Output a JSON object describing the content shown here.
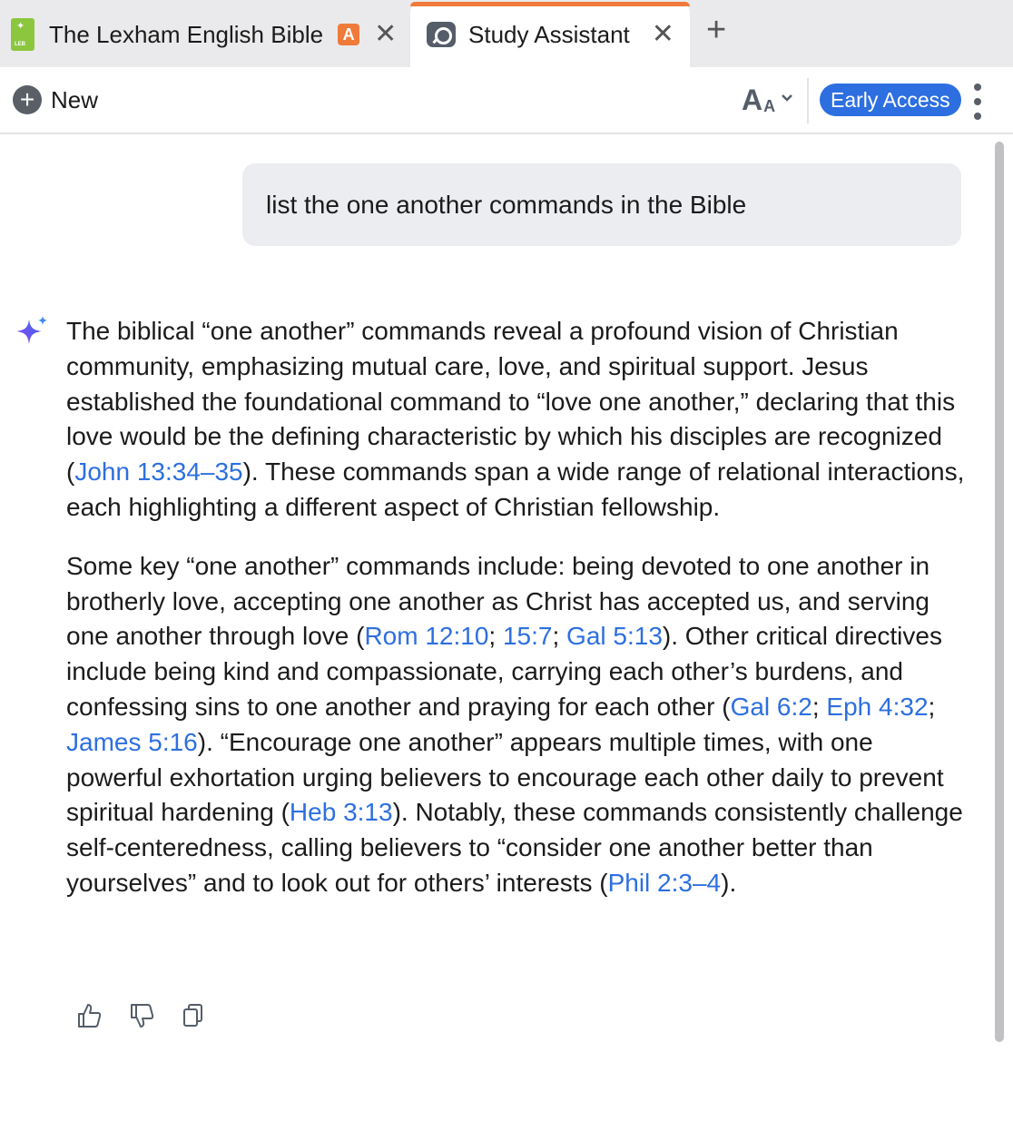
{
  "tabs": [
    {
      "label": "The Lexham English Bible",
      "badge": "A",
      "close": "✕"
    },
    {
      "label": "Study Assistant",
      "close": "✕"
    }
  ],
  "new_tab_symbol": "+",
  "toolbar": {
    "new_label": "New",
    "new_symbol": "+",
    "font_big": "A",
    "font_small": "A",
    "font_chevron": "⌄",
    "early_access_label": "Early Access"
  },
  "query": "list the one another commands in the Bible",
  "answer": {
    "p1": {
      "t1": "The biblical “one another” commands reveal a profound vision of Christian community, emphasizing mutual care, love, and spiritual support. Jesus established the foundational command to “love one another,” declaring that this love would be the defining characteristic by which his disciples are recognized (",
      "r1": "John 13:34–35",
      "t2": "). These commands span a wide range of relational interactions, each highlighting a different aspect of Christian fellowship."
    },
    "p2": {
      "t1": "Some key “one another” commands include: being devoted to one another in brotherly love, accepting one another as Christ has accepted us, and serving one another through love (",
      "r1": "Rom 12:10",
      "s1": "; ",
      "r2": "15:7",
      "s2": "; ",
      "r3": "Gal 5:13",
      "t2": "). Other critical directives include being kind and compassionate, carrying each other’s burdens, and confessing sins to one another and praying for each other (",
      "r4": "Gal 6:2",
      "s3": "; ",
      "r5": "Eph 4:32",
      "s4": "; ",
      "r6": "James 5:16",
      "t3": "). “Encourage one another” appears multiple times, with one powerful exhortation urging believers to encourage each other daily to prevent spiritual hardening (",
      "r7": "Heb 3:13",
      "t4": "). Notably, these commands consistently challenge self-centeredness, calling believers to “consider one another better than yourselves” and to look out for others’ interests (",
      "r8": "Phil 2:3–4",
      "t5": ")."
    }
  },
  "icons": {
    "tab1": "lexham-bible-icon",
    "tab2": "study-assistant-icon",
    "answer": "ai-sparkle-icon",
    "feedback": [
      "thumbs-up-icon",
      "thumbs-down-icon",
      "copy-icon"
    ]
  },
  "colors": {
    "accent": "#2d6fe0",
    "tab_indicator": "#f07a3a",
    "badge": "#f07a3a",
    "bible_icon": "#8cc63f"
  }
}
